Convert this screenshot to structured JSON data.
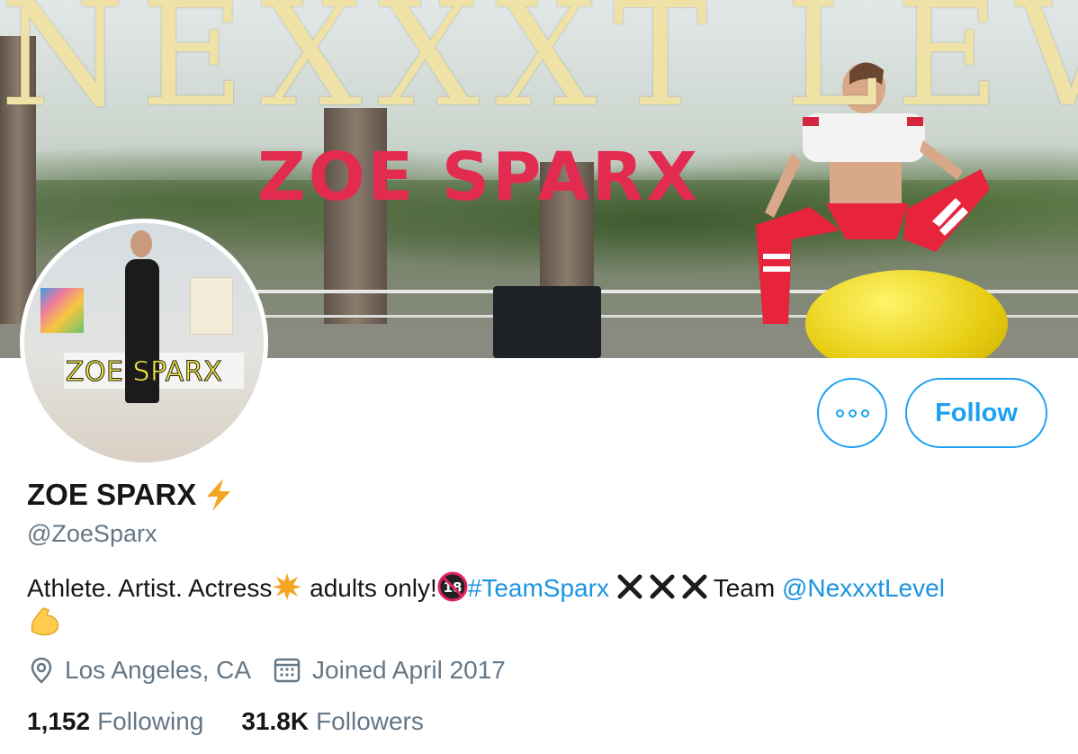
{
  "banner": {
    "title": "NEXXXT LEVEL",
    "subtitle": "ZOE SPARX"
  },
  "avatar": {
    "label": "ZOE SPARX"
  },
  "actions": {
    "more_icon": "more-dots-icon",
    "follow_label": "Follow"
  },
  "profile": {
    "display_name": "ZOE SPARX",
    "display_name_emoji": "lightning-bolt-icon",
    "handle": "@ZoeSparx",
    "bio": {
      "text1": "Athlete. Artist. Actress",
      "text2": " adults only!",
      "hashtag": "#TeamSparx",
      "text3": "Team ",
      "mention": "@NexxxtLevel"
    },
    "location": "Los Angeles, CA",
    "joined": "Joined April 2017",
    "following_count": "1,152",
    "following_label": "Following",
    "followers_count": "31.8K",
    "followers_label": "Followers"
  },
  "colors": {
    "accent": "#1da1f2",
    "link": "#1b95e0",
    "text": "#14171a",
    "muted": "#657786"
  }
}
